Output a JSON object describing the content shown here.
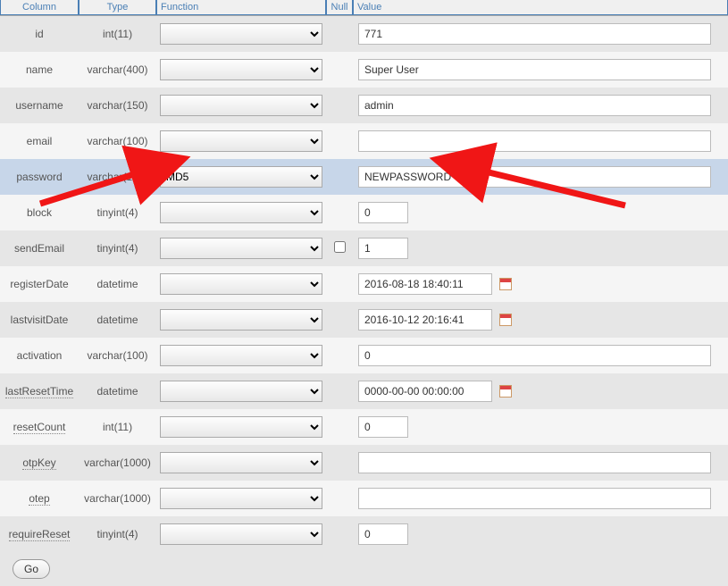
{
  "headers": {
    "column": "Column",
    "type": "Type",
    "function": "Function",
    "null": "Null",
    "value": "Value"
  },
  "rows": [
    {
      "key": "id",
      "col": "id",
      "type": "int(11)",
      "func": "",
      "null": null,
      "value": "771",
      "valueWidth": "full",
      "dotted": false,
      "hasCal": false,
      "highlight": false
    },
    {
      "key": "name",
      "col": "name",
      "type": "varchar(400)",
      "func": "",
      "null": null,
      "value": "Super User",
      "valueWidth": "full",
      "dotted": false,
      "hasCal": false,
      "highlight": false
    },
    {
      "key": "username",
      "col": "username",
      "type": "varchar(150)",
      "func": "",
      "null": null,
      "value": "admin",
      "valueWidth": "full",
      "dotted": false,
      "hasCal": false,
      "highlight": false
    },
    {
      "key": "email",
      "col": "email",
      "type": "varchar(100)",
      "func": "",
      "null": null,
      "value": "",
      "valueWidth": "full",
      "dotted": false,
      "hasCal": false,
      "highlight": false
    },
    {
      "key": "password",
      "col": "password",
      "type": "varchar(100)",
      "func": "MD5",
      "null": null,
      "value": "NEWPASSWORD",
      "valueWidth": "full",
      "dotted": false,
      "hasCal": false,
      "highlight": true
    },
    {
      "key": "block",
      "col": "block",
      "type": "tinyint(4)",
      "func": "",
      "null": null,
      "value": "0",
      "valueWidth": "short",
      "dotted": false,
      "hasCal": false,
      "highlight": false
    },
    {
      "key": "sendEmail",
      "col": "sendEmail",
      "type": "tinyint(4)",
      "func": "",
      "null": "unchecked",
      "value": "1",
      "valueWidth": "short",
      "dotted": false,
      "hasCal": false,
      "highlight": false
    },
    {
      "key": "registerDate",
      "col": "registerDate",
      "type": "datetime",
      "func": "",
      "null": null,
      "value": "2016-08-18 18:40:11",
      "valueWidth": "mid",
      "dotted": false,
      "hasCal": true,
      "highlight": false
    },
    {
      "key": "lastvisitDate",
      "col": "lastvisitDate",
      "type": "datetime",
      "func": "",
      "null": null,
      "value": "2016-10-12 20:16:41",
      "valueWidth": "mid",
      "dotted": false,
      "hasCal": true,
      "highlight": false
    },
    {
      "key": "activation",
      "col": "activation",
      "type": "varchar(100)",
      "func": "",
      "null": null,
      "value": "0",
      "valueWidth": "full",
      "dotted": false,
      "hasCal": false,
      "highlight": false
    },
    {
      "key": "lastResetTime",
      "col": "lastResetTime",
      "type": "datetime",
      "func": "",
      "null": null,
      "value": "0000-00-00 00:00:00",
      "valueWidth": "mid",
      "dotted": true,
      "hasCal": true,
      "highlight": false
    },
    {
      "key": "resetCount",
      "col": "resetCount",
      "type": "int(11)",
      "func": "",
      "null": null,
      "value": "0",
      "valueWidth": "short",
      "dotted": true,
      "hasCal": false,
      "highlight": false
    },
    {
      "key": "otpKey",
      "col": "otpKey",
      "type": "varchar(1000)",
      "func": "",
      "null": null,
      "value": "",
      "valueWidth": "full",
      "dotted": true,
      "hasCal": false,
      "highlight": false
    },
    {
      "key": "otep",
      "col": "otep",
      "type": "varchar(1000)",
      "func": "",
      "null": null,
      "value": "",
      "valueWidth": "full",
      "dotted": true,
      "hasCal": false,
      "highlight": false
    },
    {
      "key": "requireReset",
      "col": "requireReset",
      "type": "tinyint(4)",
      "func": "",
      "null": null,
      "value": "0",
      "valueWidth": "short",
      "dotted": true,
      "hasCal": false,
      "highlight": false
    }
  ],
  "goButton": "Go",
  "arrowColor": "#f01616"
}
